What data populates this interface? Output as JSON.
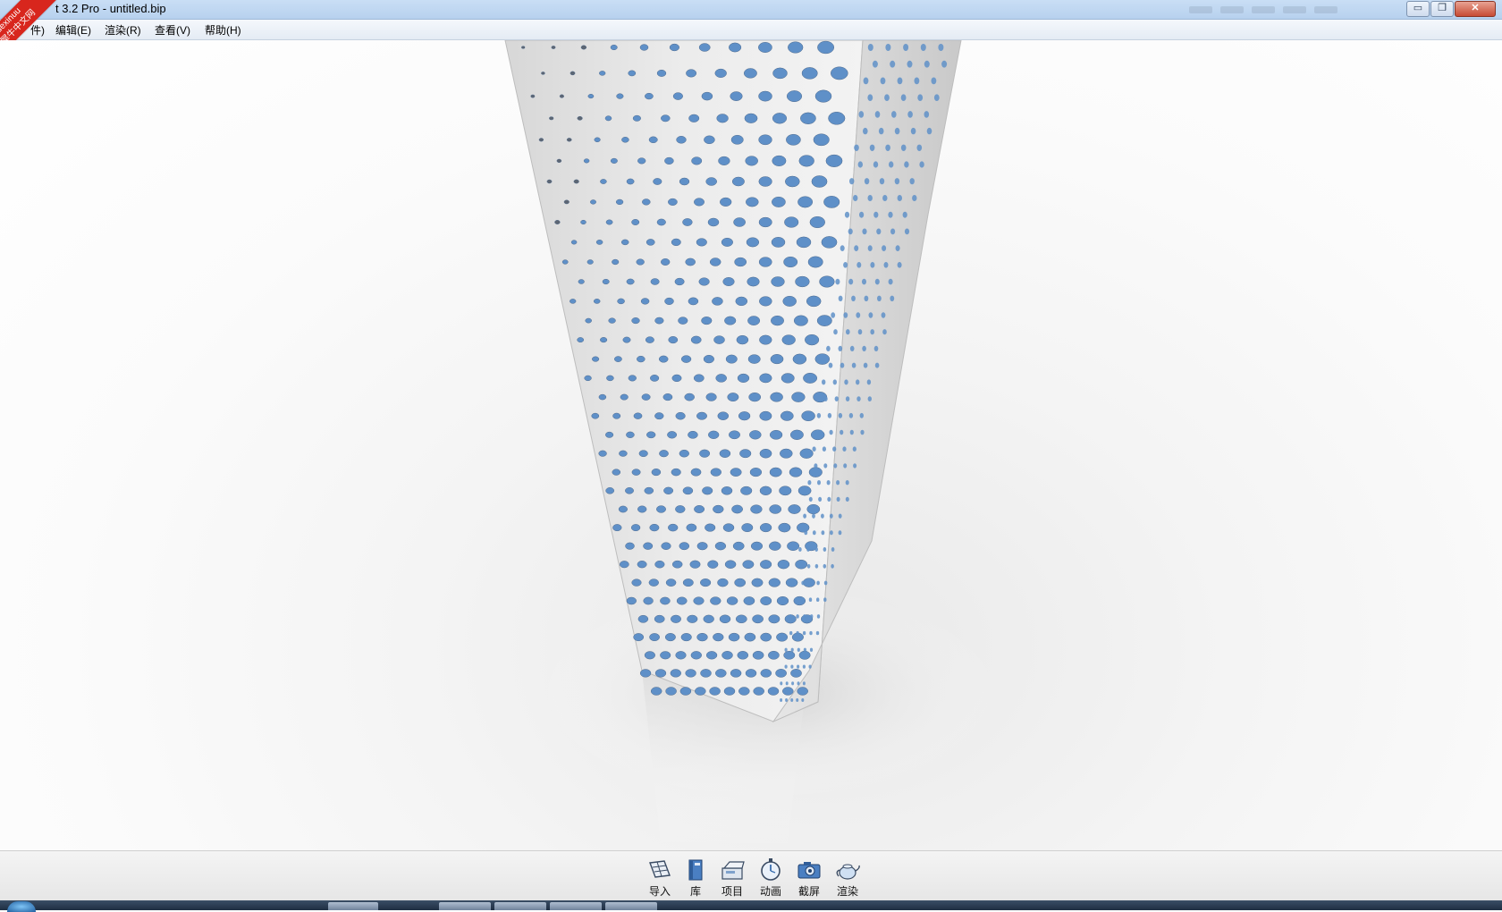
{
  "window": {
    "title": "t 3.2 Pro  - untitled.bip",
    "minimize_glyph": "▭",
    "maximize_glyph": "❐",
    "close_glyph": "✕"
  },
  "watermark": {
    "line1": "xuexinuu",
    "line2": "学犀牛中文网"
  },
  "menu": {
    "file": "件)",
    "edit": "编辑(E)",
    "render": "渲染(R)",
    "view": "查看(V)",
    "help": "帮助(H)"
  },
  "toolbar": {
    "import": "导入",
    "library": "库",
    "project": "项目",
    "animation": "动画",
    "screenshot": "截屏",
    "render": "渲染"
  },
  "icons": {
    "import": "import-icon",
    "library": "library-book-icon",
    "project": "project-icon",
    "animation": "stopwatch-icon",
    "screenshot": "camera-icon",
    "render": "teapot-icon"
  },
  "colors": {
    "accent_blue": "#5f90c8",
    "tower_white": "#ececec",
    "close_red": "#c74b34"
  }
}
